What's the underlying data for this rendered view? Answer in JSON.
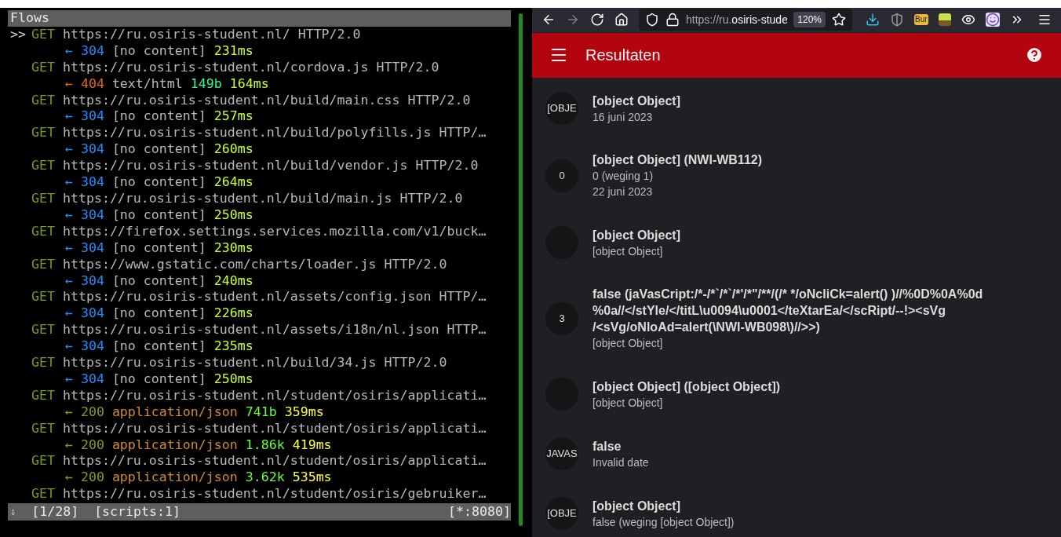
{
  "terminal": {
    "title": "Flows",
    "cursor": ">>",
    "flows": [
      {
        "selected": true,
        "method": "GET",
        "url": "https://ru.osiris-student.nl/ HTTP/2.0",
        "response": {
          "kind": "not_modified",
          "arrow": "←",
          "status": "304",
          "content": "[no content]",
          "time": "231ms"
        }
      },
      {
        "selected": false,
        "method": "GET",
        "url": "https://ru.osiris-student.nl/cordova.js HTTP/2.0",
        "response": {
          "kind": "not_found",
          "arrow": "←",
          "status": "404",
          "content": "text/html",
          "size": "149b",
          "time": "164ms"
        }
      },
      {
        "selected": false,
        "method": "GET",
        "url": "https://ru.osiris-student.nl/build/main.css HTTP/2.0",
        "response": {
          "kind": "not_modified",
          "arrow": "←",
          "status": "304",
          "content": "[no content]",
          "time": "257ms"
        }
      },
      {
        "selected": false,
        "method": "GET",
        "url": "https://ru.osiris-student.nl/build/polyfills.js HTTP/…",
        "response": {
          "kind": "not_modified",
          "arrow": "←",
          "status": "304",
          "content": "[no content]",
          "time": "260ms"
        }
      },
      {
        "selected": false,
        "method": "GET",
        "url": "https://ru.osiris-student.nl/build/vendor.js HTTP/2.0",
        "response": {
          "kind": "not_modified",
          "arrow": "←",
          "status": "304",
          "content": "[no content]",
          "time": "264ms"
        }
      },
      {
        "selected": false,
        "method": "GET",
        "url": "https://ru.osiris-student.nl/build/main.js HTTP/2.0",
        "response": {
          "kind": "not_modified",
          "arrow": "←",
          "status": "304",
          "content": "[no content]",
          "time": "250ms"
        }
      },
      {
        "selected": false,
        "method": "GET",
        "url": "https://firefox.settings.services.mozilla.com/v1/buck…",
        "response": {
          "kind": "not_modified",
          "arrow": "←",
          "status": "304",
          "content": "[no content]",
          "time": "230ms"
        }
      },
      {
        "selected": false,
        "method": "GET",
        "url": "https://www.gstatic.com/charts/loader.js HTTP/2.0",
        "response": {
          "kind": "not_modified",
          "arrow": "←",
          "status": "304",
          "content": "[no content]",
          "time": "240ms"
        }
      },
      {
        "selected": false,
        "method": "GET",
        "url": "https://ru.osiris-student.nl/assets/config.json HTTP/…",
        "response": {
          "kind": "not_modified",
          "arrow": "←",
          "status": "304",
          "content": "[no content]",
          "time": "226ms"
        }
      },
      {
        "selected": false,
        "method": "GET",
        "url": "https://ru.osiris-student.nl/assets/i18n/nl.json HTTP…",
        "response": {
          "kind": "not_modified",
          "arrow": "←",
          "status": "304",
          "content": "[no content]",
          "time": "235ms"
        }
      },
      {
        "selected": false,
        "method": "GET",
        "url": "https://ru.osiris-student.nl/build/34.js HTTP/2.0",
        "response": {
          "kind": "not_modified",
          "arrow": "←",
          "status": "304",
          "content": "[no content]",
          "time": "250ms"
        }
      },
      {
        "selected": false,
        "method": "GET",
        "url": "https://ru.osiris-student.nl/student/osiris/applicati…",
        "response": {
          "kind": "ok",
          "arrow": "←",
          "status": "200",
          "content": "application/json",
          "size": "741b",
          "time": "359ms"
        }
      },
      {
        "selected": false,
        "method": "GET",
        "url": "https://ru.osiris-student.nl/student/osiris/applicati…",
        "response": {
          "kind": "ok",
          "arrow": "←",
          "status": "200",
          "content": "application/json",
          "size": "1.86k",
          "time": "419ms"
        }
      },
      {
        "selected": false,
        "method": "GET",
        "url": "https://ru.osiris-student.nl/student/osiris/applicati…",
        "response": {
          "kind": "ok",
          "arrow": "←",
          "status": "200",
          "content": "application/json",
          "size": "3.62k",
          "time": "535ms"
        }
      },
      {
        "selected": false,
        "method": "GET",
        "url": "https://ru.osiris-student.nl/student/osiris/gebruiker…"
      }
    ],
    "status_bar": {
      "arrow": "⇩",
      "position": "[1/28]",
      "scripts": "[scripts:1]",
      "listen": "[*:8080]"
    }
  },
  "browser": {
    "forward_enabled": false,
    "url_scheme": "https://ru.",
    "url_host": "osiris-stude",
    "zoom": "120%",
    "extension_badge": "Bur",
    "app_bar": {
      "title": "Resultaten"
    },
    "results": [
      {
        "avatar": "[OBJE",
        "title": "[object Object]",
        "lines": [
          "16 juni 2023"
        ]
      },
      {
        "avatar": "0",
        "title": "[object Object] (NWI-WB112)",
        "lines": [
          "0 (weging 1)",
          "22 juni 2023"
        ]
      },
      {
        "title": "[object Object]",
        "lines": [
          "[object Object]"
        ]
      },
      {
        "avatar": "3",
        "title": "false (jaVasCript:/*-/*`/*`/*'/*\"/**/(/* */oNcliCk=alert() )//%0D%0A%0d %0a//</stYle/</titL\\u0094\\u0001</teXtarEa/</scRipt/--!><sVg /<sVg/oNloAd=alert(\\NWI-WB098\\)//>>)",
        "lines": [
          "[object Object]"
        ]
      },
      {
        "title": "[object Object] ([object Object])",
        "lines": [
          "[object Object]"
        ]
      },
      {
        "avatar": "JAVAS",
        "title": "false",
        "lines": [
          "Invalid date"
        ]
      },
      {
        "avatar": "[OBJE",
        "title": "[object Object]",
        "lines": [
          "false (weging [object Object])"
        ]
      }
    ]
  }
}
